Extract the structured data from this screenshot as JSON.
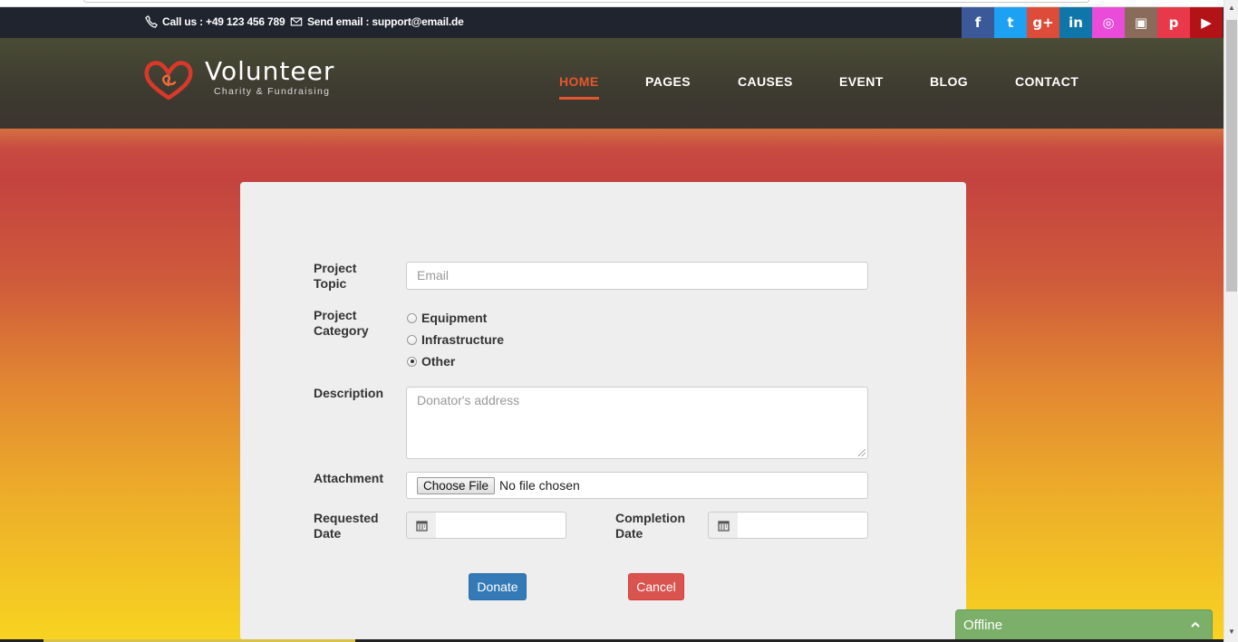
{
  "topbar": {
    "phone_text": "Call us : +49 123 456 789",
    "email_text": "Send email : support@email.de",
    "social": [
      {
        "name": "facebook",
        "glyph": "f",
        "color": "#3b5998"
      },
      {
        "name": "twitter",
        "glyph": "t",
        "color": "#1da1f2"
      },
      {
        "name": "google-plus",
        "glyph": "g+",
        "color": "#dd4b39"
      },
      {
        "name": "linkedin",
        "glyph": "in",
        "color": "#0e76a8"
      },
      {
        "name": "dribbble",
        "glyph": "◎",
        "color": "#ea4cd9"
      },
      {
        "name": "instagram",
        "glyph": "▣",
        "color": "#8a6a5a"
      },
      {
        "name": "pinterest",
        "glyph": "p",
        "color": "#e8394a"
      },
      {
        "name": "youtube",
        "glyph": "▶",
        "color": "#b31217"
      }
    ]
  },
  "brand": {
    "name": "Volunteer",
    "tagline": "Charity & Fundraising",
    "logo_color": "#d8392b"
  },
  "nav": {
    "items": [
      "HOME",
      "PAGES",
      "CAUSES",
      "EVENT",
      "BLOG",
      "CONTACT"
    ],
    "active": "HOME"
  },
  "form": {
    "topic_label": "Project Topic",
    "topic_placeholder": "Email",
    "category_label": "Project Category",
    "categories": [
      {
        "label": "Equipment",
        "checked": false
      },
      {
        "label": "Infrastructure",
        "checked": false
      },
      {
        "label": "Other",
        "checked": true
      }
    ],
    "description_label": "Description",
    "description_placeholder": "Donator's address",
    "attachment_label": "Attachment",
    "file_button": "Choose File",
    "file_status": "No file chosen",
    "requested_label": "Requested Date",
    "completion_label": "Completion Date",
    "donate_label": "Donate",
    "cancel_label": "Cancel"
  },
  "chat": {
    "status": "Offline"
  }
}
